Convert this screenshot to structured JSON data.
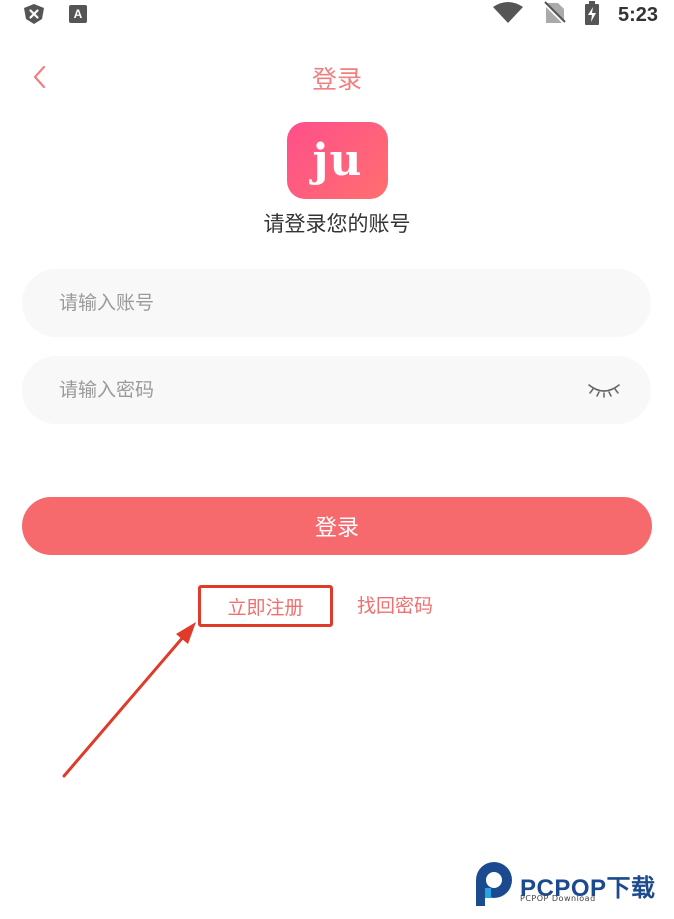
{
  "status_bar": {
    "time": "5:23"
  },
  "header": {
    "title": "登录"
  },
  "logo": {
    "text": "ju"
  },
  "subtitle": "请登录您的账号",
  "account_field": {
    "placeholder": "请输入账号",
    "value": ""
  },
  "password_field": {
    "placeholder": "请输入密码",
    "value": ""
  },
  "login_button": {
    "label": "登录"
  },
  "links": {
    "register": "立即注册",
    "forgot_password": "找回密码"
  },
  "watermark": {
    "title": "PCPOP下载",
    "subtitle": "PCPOP Download"
  },
  "colors": {
    "accent": "#f66a6e",
    "link": "#f07070",
    "annotation": "#e03a2a"
  }
}
